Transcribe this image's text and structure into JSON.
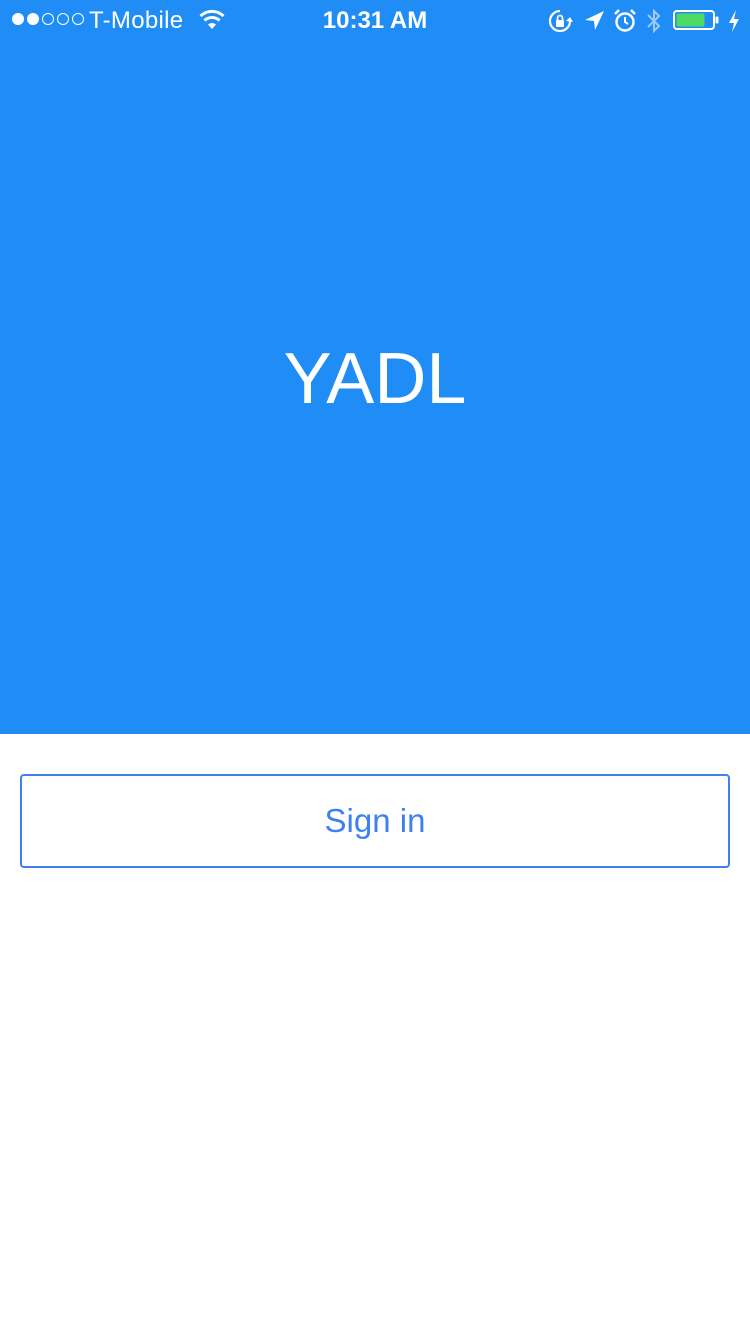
{
  "status_bar": {
    "carrier": "T-Mobile",
    "time": "10:31 AM",
    "signal_bars_filled": 2,
    "signal_bars_total": 5,
    "battery_level": 0.75,
    "icons": [
      "wifi-icon",
      "orientation-lock-icon",
      "location-arrow-icon",
      "alarm-icon",
      "bluetooth-icon",
      "battery-icon",
      "charging-bolt-icon"
    ]
  },
  "hero": {
    "title": "YADL",
    "background_color": "#1f8df5"
  },
  "actions": {
    "sign_in_label": "Sign in",
    "accent_color": "#3f80ee"
  }
}
